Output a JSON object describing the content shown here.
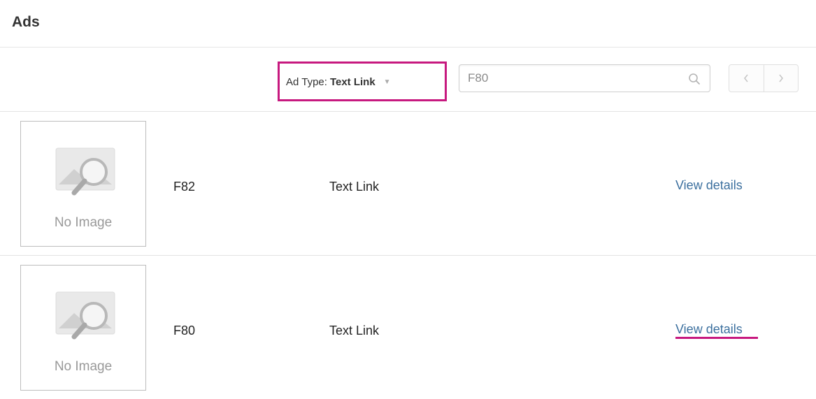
{
  "page": {
    "title": "Ads"
  },
  "filter": {
    "label": "Ad Type:",
    "value": "Text Link",
    "caret_icon": "caret-down-icon"
  },
  "search": {
    "value": "F80",
    "icon": "search-icon"
  },
  "pager": {
    "prev_icon": "chevron-left-icon",
    "next_icon": "chevron-right-icon"
  },
  "ads": [
    {
      "thumbnail_label": "No Image",
      "name": "F82",
      "type": "Text Link",
      "link": "View details"
    },
    {
      "thumbnail_label": "No Image",
      "name": "F80",
      "type": "Text Link",
      "link": "View details"
    }
  ],
  "colors": {
    "highlight": "#c7197f",
    "link": "#3b6f9e"
  }
}
